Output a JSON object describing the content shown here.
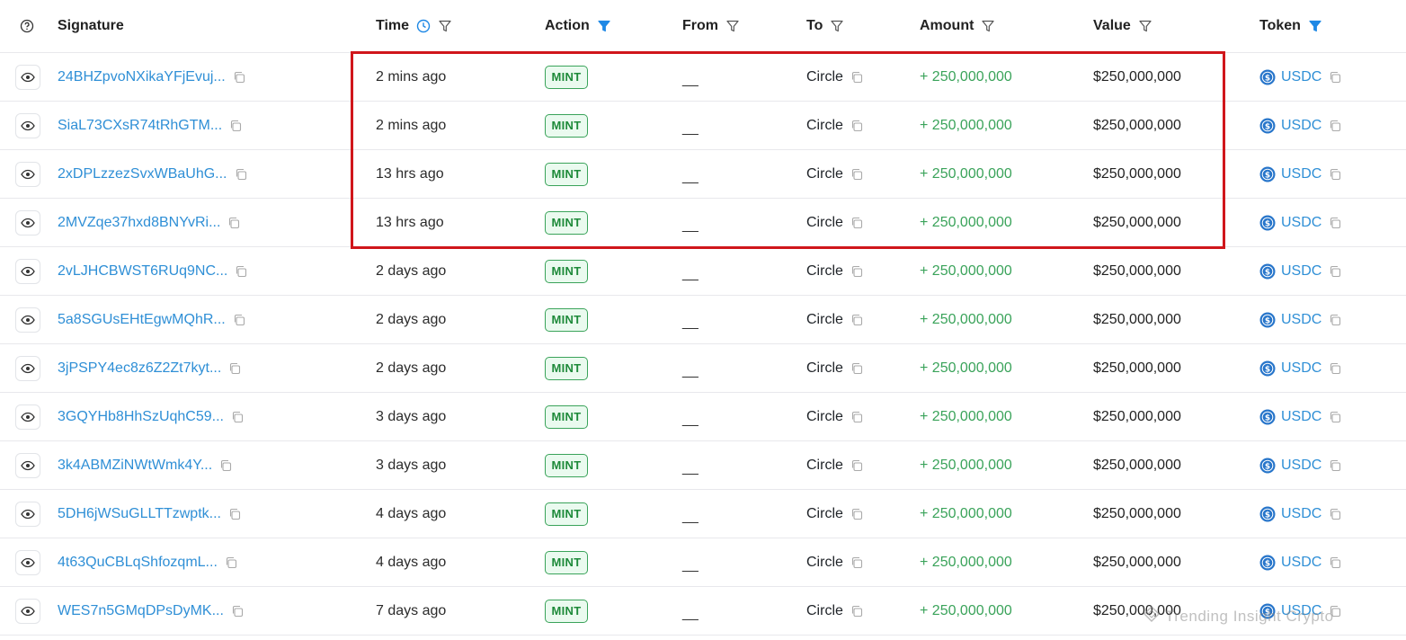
{
  "header": {
    "signature": "Signature",
    "time": "Time",
    "action": "Action",
    "from": "From",
    "to": "To",
    "amount": "Amount",
    "value": "Value",
    "token": "Token"
  },
  "colors": {
    "link": "#2f8fd6",
    "mint_green": "#3aa35a",
    "highlight_red": "#d0161b",
    "active_filter": "#1e88e5"
  },
  "icons": {
    "help": "question-circle-icon",
    "filter": "funnel-icon",
    "filter_active": "funnel-filled-icon",
    "clock": "clock-icon",
    "view": "eye-icon",
    "copy": "copy-icon",
    "token": "usdc-coin-icon"
  },
  "rows": [
    {
      "signature": "24BHZpvoNXikaYFjEvuj...",
      "time": "2 mins ago",
      "action": "MINT",
      "from": "__",
      "to": "Circle",
      "amount": "+ 250,000,000",
      "value": "$250,000,000",
      "token": "USDC"
    },
    {
      "signature": "SiaL73CXsR74tRhGTM...",
      "time": "2 mins ago",
      "action": "MINT",
      "from": "__",
      "to": "Circle",
      "amount": "+ 250,000,000",
      "value": "$250,000,000",
      "token": "USDC"
    },
    {
      "signature": "2xDPLzzezSvxWBaUhG...",
      "time": "13 hrs ago",
      "action": "MINT",
      "from": "__",
      "to": "Circle",
      "amount": "+ 250,000,000",
      "value": "$250,000,000",
      "token": "USDC"
    },
    {
      "signature": "2MVZqe37hxd8BNYvRi...",
      "time": "13 hrs ago",
      "action": "MINT",
      "from": "__",
      "to": "Circle",
      "amount": "+ 250,000,000",
      "value": "$250,000,000",
      "token": "USDC"
    },
    {
      "signature": "2vLJHCBWST6RUq9NC...",
      "time": "2 days ago",
      "action": "MINT",
      "from": "__",
      "to": "Circle",
      "amount": "+ 250,000,000",
      "value": "$250,000,000",
      "token": "USDC"
    },
    {
      "signature": "5a8SGUsEHtEgwMQhR...",
      "time": "2 days ago",
      "action": "MINT",
      "from": "__",
      "to": "Circle",
      "amount": "+ 250,000,000",
      "value": "$250,000,000",
      "token": "USDC"
    },
    {
      "signature": "3jPSPY4ec8z6Z2Zt7kyt...",
      "time": "2 days ago",
      "action": "MINT",
      "from": "__",
      "to": "Circle",
      "amount": "+ 250,000,000",
      "value": "$250,000,000",
      "token": "USDC"
    },
    {
      "signature": "3GQYHb8HhSzUqhC59...",
      "time": "3 days ago",
      "action": "MINT",
      "from": "__",
      "to": "Circle",
      "amount": "+ 250,000,000",
      "value": "$250,000,000",
      "token": "USDC"
    },
    {
      "signature": "3k4ABMZiNWtWmk4Y...",
      "time": "3 days ago",
      "action": "MINT",
      "from": "__",
      "to": "Circle",
      "amount": "+ 250,000,000",
      "value": "$250,000,000",
      "token": "USDC"
    },
    {
      "signature": "5DH6jWSuGLLTTzwptk...",
      "time": "4 days ago",
      "action": "MINT",
      "from": "__",
      "to": "Circle",
      "amount": "+ 250,000,000",
      "value": "$250,000,000",
      "token": "USDC"
    },
    {
      "signature": "4t63QuCBLqShfozqmL...",
      "time": "4 days ago",
      "action": "MINT",
      "from": "__",
      "to": "Circle",
      "amount": "+ 250,000,000",
      "value": "$250,000,000",
      "token": "USDC"
    },
    {
      "signature": "WES7n5GMqDPsDyMK...",
      "time": "7 days ago",
      "action": "MINT",
      "from": "__",
      "to": "Circle",
      "amount": "+ 250,000,000",
      "value": "$250,000,000",
      "token": "USDC"
    }
  ],
  "watermark": "Trending Insight Crypto"
}
